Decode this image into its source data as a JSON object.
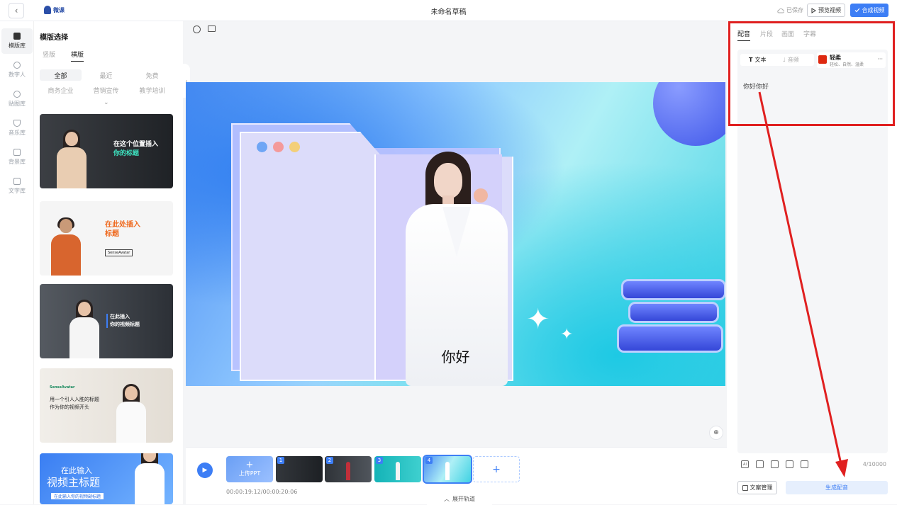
{
  "topbar": {
    "back_glyph": "‹",
    "logo_text": "微课",
    "title": "未命名草稿",
    "saved_text": "已保存",
    "preview_label": "预览视频",
    "compose_label": "合成视频"
  },
  "leftnav": {
    "items": [
      {
        "label": "模版库",
        "icon": "template-icon"
      },
      {
        "label": "数字人",
        "icon": "avatar-icon"
      },
      {
        "label": "贴图库",
        "icon": "sticker-icon"
      },
      {
        "label": "音乐库",
        "icon": "music-icon"
      },
      {
        "label": "背景库",
        "icon": "image-icon"
      },
      {
        "label": "文字库",
        "icon": "text-icon"
      }
    ]
  },
  "templates": {
    "title": "模版选择",
    "tabs": [
      "竖版",
      "横版"
    ],
    "filters": [
      "全部",
      "最近",
      "免费",
      "商务企业",
      "营销宣传",
      "教学培训"
    ],
    "cards": [
      {
        "line1": "在这个位置插入",
        "line2": "你的标题"
      },
      {
        "line1": "在此处插入",
        "line2": "标题",
        "brand": "SenseAvatar"
      },
      {
        "line1": "在此插入",
        "line2": "你的视频标题"
      },
      {
        "line1": "用一个引人入胜的标题",
        "line2": "作为你的视频开头",
        "brand": "SenseAvatar"
      },
      {
        "line1": "在此输入",
        "line2": "视频主标题",
        "line3": "在此输入你的视频副标题"
      }
    ]
  },
  "canvas": {
    "subtitle": "你好"
  },
  "timeline": {
    "upload_label": "上传PPT",
    "clips": [
      "1",
      "2",
      "3",
      "4"
    ],
    "time": "00:00:19:12/00:00:20:06",
    "expand_label": "展开轨道"
  },
  "right": {
    "tabs": [
      "配音",
      "片段",
      "画面",
      "字幕"
    ],
    "mode_text": "文本",
    "mode_audio": "音频",
    "voice_name": "轻柔",
    "voice_desc": "轻松、自然、温柔",
    "voice_more": "···",
    "script": "你好你好",
    "count": "4/10000",
    "doc_mgmt": "文案管理",
    "generate": "生成配音"
  },
  "colors": {
    "accent": "#3d7ef5",
    "annotation": "#e02020"
  }
}
